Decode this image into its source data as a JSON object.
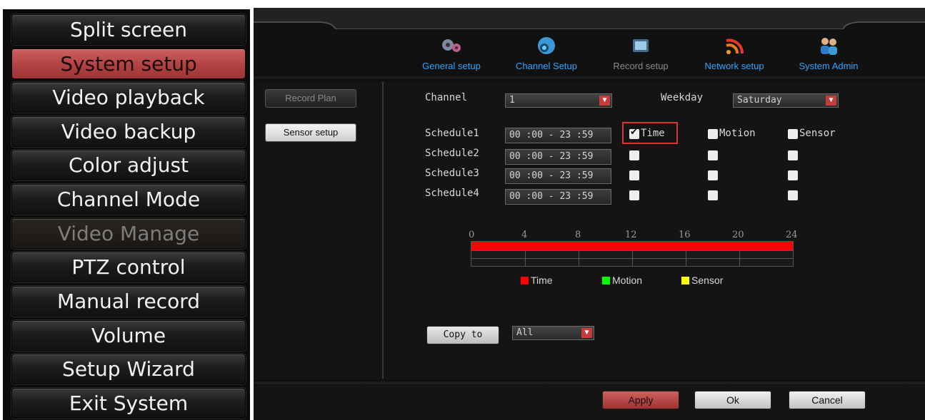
{
  "menu": {
    "items": [
      {
        "label": "Split screen",
        "state": "normal"
      },
      {
        "label": "System setup",
        "state": "active"
      },
      {
        "label": "Video playback",
        "state": "normal"
      },
      {
        "label": "Video backup",
        "state": "normal"
      },
      {
        "label": "Color adjust",
        "state": "normal"
      },
      {
        "label": "Channel Mode",
        "state": "normal"
      },
      {
        "label": "Video Manage",
        "state": "disabled"
      },
      {
        "label": "PTZ control",
        "state": "normal"
      },
      {
        "label": "Manual record",
        "state": "normal"
      },
      {
        "label": "Volume",
        "state": "normal"
      },
      {
        "label": "Setup Wizard",
        "state": "normal"
      },
      {
        "label": "Exit System",
        "state": "normal"
      }
    ]
  },
  "tabs": [
    {
      "label": "General setup",
      "icon": "gears-icon"
    },
    {
      "label": "Channel Setup",
      "icon": "camera-icon"
    },
    {
      "label": "Record setup",
      "icon": "video-icon"
    },
    {
      "label": "Network setup",
      "icon": "wifi-icon"
    },
    {
      "label": "System Admin",
      "icon": "users-icon"
    }
  ],
  "side": {
    "record_plan": "Record Plan",
    "sensor_setup": "Sensor setup"
  },
  "form": {
    "channel_label": "Channel",
    "channel_value": "1",
    "weekday_label": "Weekday",
    "weekday_value": "Saturday",
    "schedules": [
      {
        "label": "Schedule1",
        "time": "00 :00 - 23 :59",
        "time_checked": true,
        "motion_checked": false,
        "sensor_checked": false
      },
      {
        "label": "Schedule2",
        "time": "00 :00 - 23 :59",
        "time_checked": false,
        "motion_checked": false,
        "sensor_checked": false
      },
      {
        "label": "Schedule3",
        "time": "00 :00 - 23 :59",
        "time_checked": false,
        "motion_checked": false,
        "sensor_checked": false
      },
      {
        "label": "Schedule4",
        "time": "00 :00 - 23 :59",
        "time_checked": false,
        "motion_checked": false,
        "sensor_checked": false
      }
    ],
    "time_label": "Time",
    "motion_label": "Motion",
    "sensor_label": "Sensor"
  },
  "timeline": {
    "ticks": [
      "0",
      "4",
      "8",
      "12",
      "16",
      "20",
      "24"
    ],
    "recorded_hours": [
      0,
      24
    ],
    "legend": [
      {
        "label": "Time",
        "color": "#ff0000"
      },
      {
        "label": "Motion",
        "color": "#00ff00"
      },
      {
        "label": "Sensor",
        "color": "#ffff00"
      }
    ]
  },
  "copy": {
    "button": "Copy to",
    "value": "All"
  },
  "actions": {
    "apply": "Apply",
    "ok": "Ok",
    "cancel": "Cancel"
  },
  "colors": {
    "accent_red": "#c73b3b",
    "tab_blue": "#2fa5ff"
  }
}
